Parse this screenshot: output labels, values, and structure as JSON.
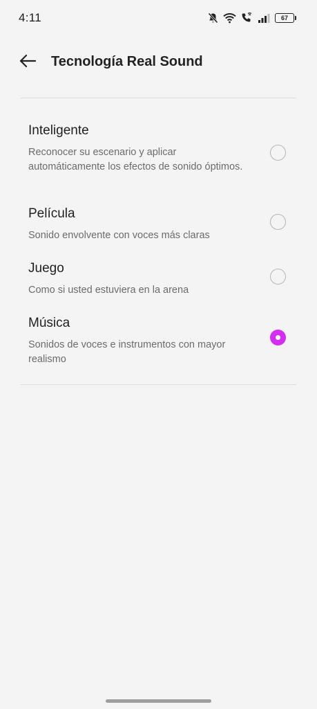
{
  "status_bar": {
    "time": "4:11",
    "battery_level": "67",
    "icons": [
      "mute-bell-icon",
      "wifi-icon",
      "wifi-call-icon",
      "signal-icon",
      "battery-icon"
    ]
  },
  "header": {
    "title": "Tecnología Real Sound",
    "back_icon": "back-arrow-icon"
  },
  "options": [
    {
      "title": "Inteligente",
      "description": "Reconocer su escenario y aplicar automáticamente los efectos de sonido óptimos.",
      "selected": false
    },
    {
      "title": "Película",
      "description": "Sonido envolvente con voces más claras",
      "selected": false
    },
    {
      "title": "Juego",
      "description": "Como si usted estuviera en la arena",
      "selected": false
    },
    {
      "title": "Música",
      "description": "Sonidos de voces e instrumentos con mayor realismo",
      "selected": true
    }
  ],
  "colors": {
    "accent": "#d52cf5",
    "background": "#f4f4f4",
    "text_primary": "#1f1f1f",
    "text_secondary": "#6b6b6b"
  }
}
